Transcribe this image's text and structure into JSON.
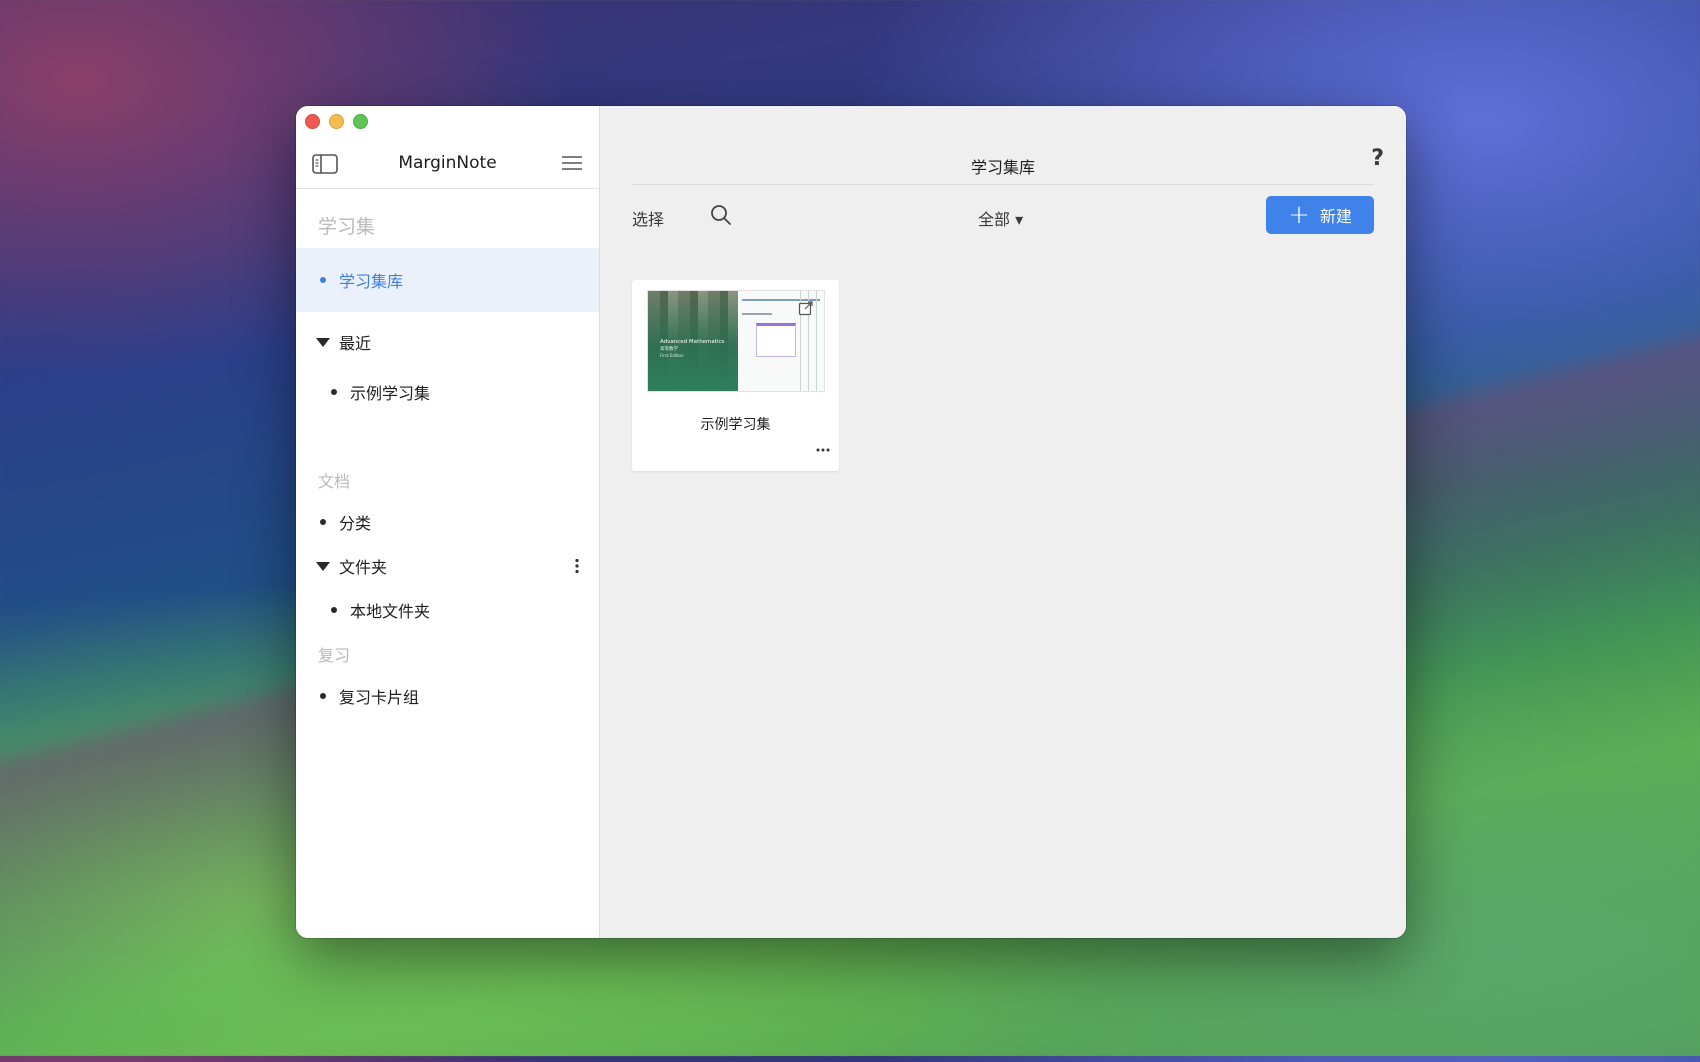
{
  "app": {
    "title": "MarginNote"
  },
  "sidebar": {
    "section_study": "学习集",
    "study_library": "学习集库",
    "recent_label": "最近",
    "recent_items": [
      "示例学习集"
    ],
    "section_docs": "文档",
    "category_label": "分类",
    "folders_label": "文件夹",
    "folder_items": [
      "本地文件夹"
    ],
    "section_review": "复习",
    "review_decks": "复习卡片组"
  },
  "main": {
    "title": "学习集库",
    "help": "?",
    "select_label": "选择",
    "filter_label": "全部 ▾",
    "new_label": "新建",
    "cards": [
      {
        "title": "示例学习集",
        "cover_title": "Advanced Mathematics",
        "cover_subtitle": "高等数学",
        "cover_edition": "First Edition"
      }
    ]
  },
  "colors": {
    "accent": "#3f82ea",
    "selected_bg": "#eaf1fa",
    "selected_text": "#3f7fe0"
  }
}
